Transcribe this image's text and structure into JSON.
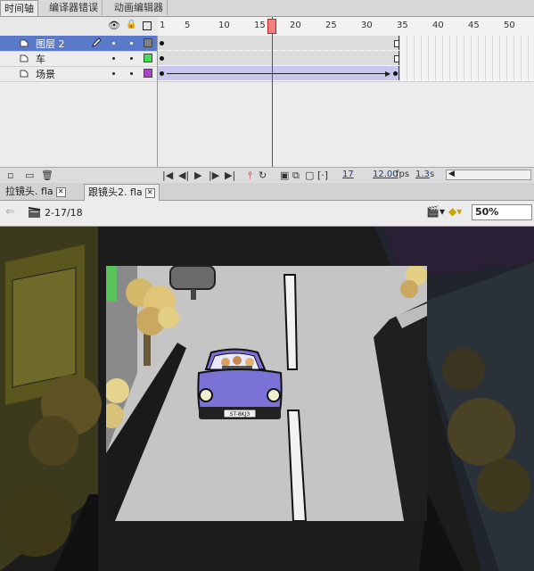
{
  "top_tabs": [
    "时间轴",
    "编译器错误",
    "动画编辑器"
  ],
  "ruler": {
    "marks": [
      "1",
      "5",
      "10",
      "15",
      "20",
      "25",
      "30",
      "35",
      "40",
      "45",
      "50"
    ]
  },
  "layers": [
    {
      "name": "图层 2",
      "selected": true,
      "color": "#808080"
    },
    {
      "name": "车",
      "selected": false,
      "color": "#44dd55"
    },
    {
      "name": "场景",
      "selected": false,
      "color": "#aa44cc"
    }
  ],
  "timeline_status": {
    "current_frame": "17",
    "fps": "12.00",
    "fps_unit": "fps",
    "time": "1.3",
    "time_unit": "s"
  },
  "doc_tabs": [
    {
      "label": "拉镜头. fla",
      "active": false
    },
    {
      "label": "跟镜头2. fla",
      "active": true
    }
  ],
  "edit_bar": {
    "scene_label": "2-17/18",
    "zoom": "50%"
  },
  "car": {
    "plate": "ST-8KJ3"
  },
  "colors": {
    "playhead": "#d02020",
    "selected_layer": "#5b79c9",
    "car_body": "#7b72d6",
    "stage_road": "#c5c5c5"
  }
}
